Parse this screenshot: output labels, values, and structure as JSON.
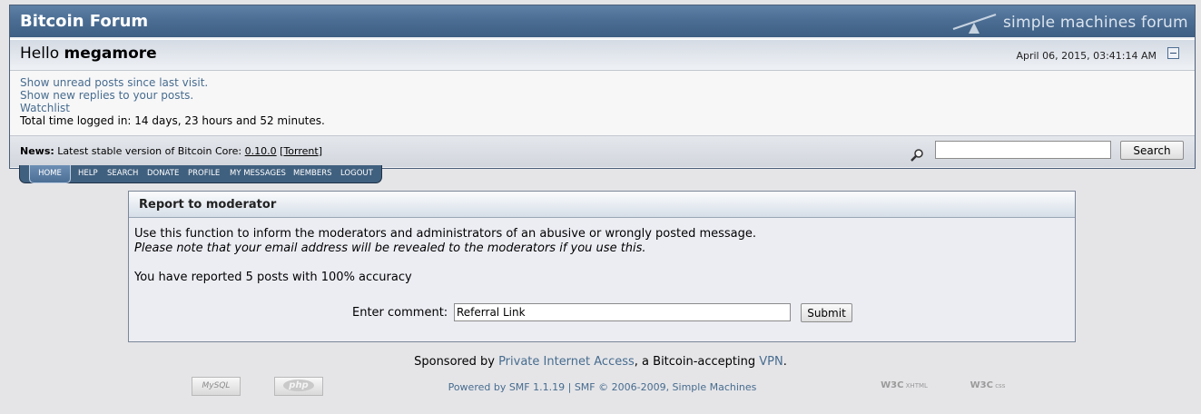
{
  "header": {
    "forum_title": "Bitcoin Forum",
    "logo_text": "simple machines forum",
    "hello_prefix": "Hello",
    "username": "megamore",
    "datetime": "April 06, 2015, 03:41:14 AM"
  },
  "userinfo": {
    "unread_link": "Show unread posts since last visit.",
    "replies_link": "Show new replies to your posts.",
    "watchlist_link": "Watchlist",
    "time_logged": "Total time logged in: 14 days, 23 hours and 52 minutes."
  },
  "news": {
    "label": "News:",
    "text": "Latest stable version of Bitcoin Core:",
    "version_link": "0.10.0",
    "torrent_open": "[",
    "torrent_link": "Torrent",
    "torrent_close": "]"
  },
  "search": {
    "button_label": "Search",
    "value": ""
  },
  "nav": {
    "tabs": [
      "HOME",
      "HELP",
      "SEARCH",
      "DONATE",
      "PROFILE",
      "MY MESSAGES",
      "MEMBERS",
      "LOGOUT"
    ],
    "active": "HOME"
  },
  "report": {
    "title": "Report to moderator",
    "line1": "Use this function to inform the moderators and administrators of an abusive or wrongly posted message.",
    "line2": "Please note that your email address will be revealed to the moderators if you use this.",
    "line3": "You have reported 5 posts with 100% accuracy",
    "comment_label": "Enter comment:",
    "comment_value": "Referral Link",
    "submit_label": "Submit"
  },
  "footer": {
    "sponsor_prefix": "Sponsored by",
    "sponsor_link": "Private Internet Access",
    "sponsor_middle": ", a Bitcoin-accepting",
    "vpn_link": "VPN",
    "sponsor_suffix": ".",
    "powered_by": "Powered by SMF 1.1.19 | SMF © 2006-2009, Simple Machines",
    "badge_mysql": "MySQL",
    "badge_php": "php",
    "badge_xhtml": "XHTML 1.0",
    "badge_css": "css"
  },
  "colors": {
    "title_bar": "#4c6e94",
    "link": "#476c8e",
    "page_bg": "#e5e5e8"
  }
}
